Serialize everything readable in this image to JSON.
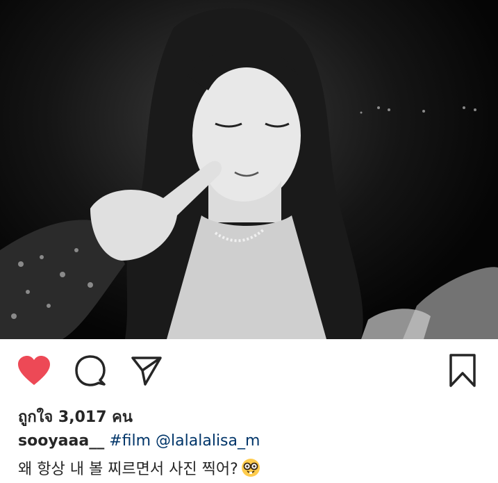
{
  "post": {
    "photo": {
      "alt_icon": "photo-black-and-white"
    },
    "actions": {
      "like_icon": "heart-filled-icon",
      "comment_icon": "comment-bubble-icon",
      "share_icon": "paper-plane-icon",
      "save_icon": "bookmark-icon",
      "like_color": "#ed4956"
    },
    "likes": {
      "text": "ถูกใจ 3,017 คน"
    },
    "caption": {
      "username": "sooyaaa__",
      "hashtag": "#film",
      "mention": "@lalalalisa_m",
      "text": "왜 항상 내 볼 찌르면서 사진 찍어?",
      "emoji": "nerd-face-emoji"
    }
  }
}
